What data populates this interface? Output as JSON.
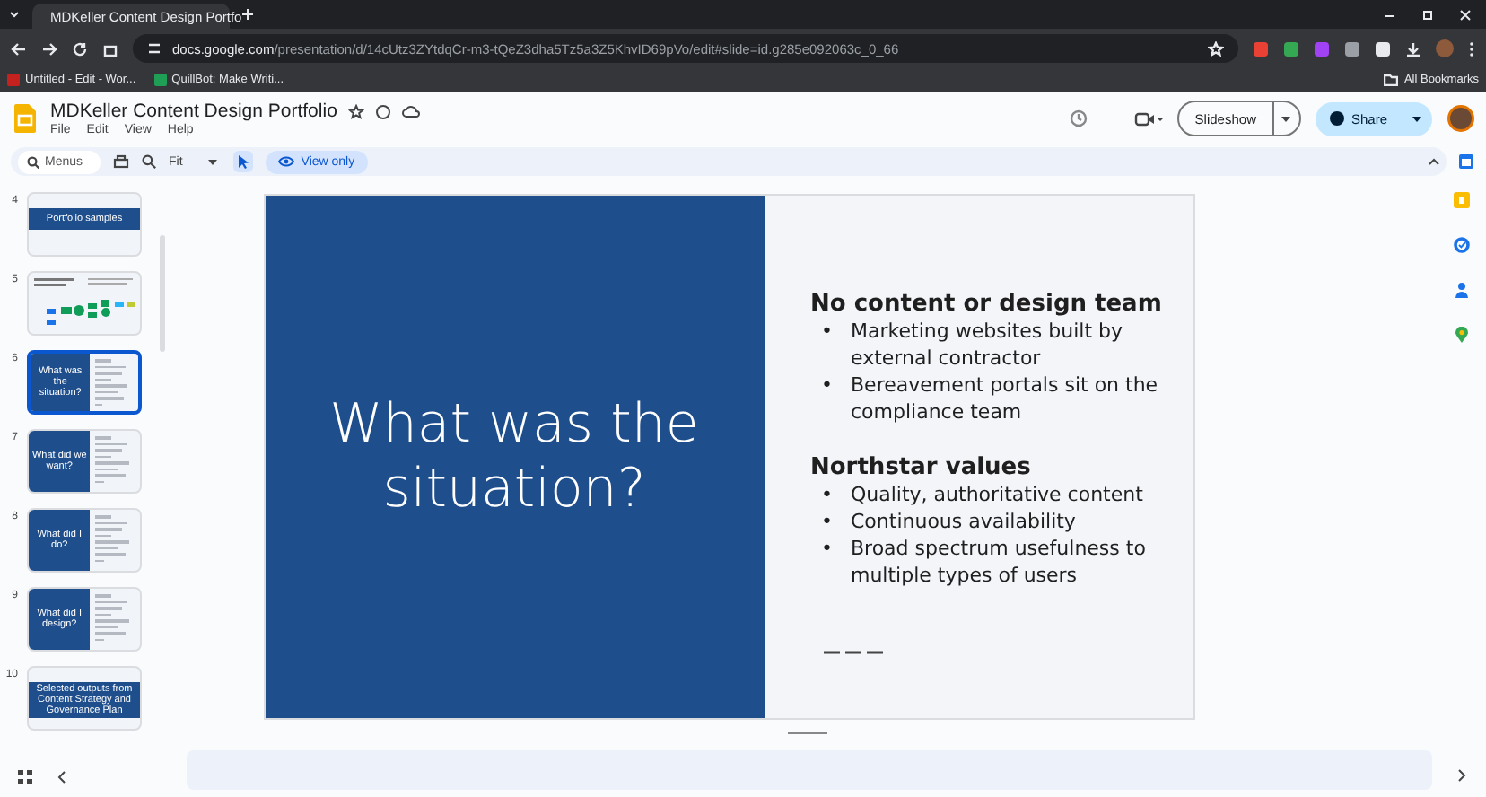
{
  "browser": {
    "tab_title": "MDKeller Content Design Portfo",
    "url_host": "docs.google.com",
    "url_path": "/presentation/d/14cUtz3ZYtdqCr-m3-tQeZ3dha5Tz5a3Z5KhvID69pVo/edit#slide=id.g285e092063c_0_66",
    "bookmarks": [
      "Untitled - Edit - Wor...",
      "QuillBot: Make Writi..."
    ],
    "all_bookmarks": "All Bookmarks"
  },
  "document": {
    "title": "MDKeller Content Design Portfolio",
    "menus": [
      "File",
      "Edit",
      "View",
      "Help"
    ],
    "slideshow_button": "Slideshow",
    "share_button": "Share"
  },
  "toolbar": {
    "search_placeholder": "Menus",
    "zoom": "Fit",
    "view_only": "View only"
  },
  "slides": [
    {
      "number": "4",
      "kind": "title-bar",
      "title": "Portfolio samples",
      "selected": false
    },
    {
      "number": "5",
      "kind": "diagram",
      "selected": false
    },
    {
      "number": "6",
      "kind": "split",
      "title": "What was the situation?",
      "selected": true
    },
    {
      "number": "7",
      "kind": "split",
      "title": "What did we want?",
      "selected": false
    },
    {
      "number": "8",
      "kind": "split",
      "title": "What did I do?",
      "selected": false
    },
    {
      "number": "9",
      "kind": "split",
      "title": "What did I design?",
      "selected": false
    },
    {
      "number": "10",
      "kind": "title-bar",
      "title": "Selected outputs from Content Strategy and Governance Plan",
      "selected": false
    }
  ],
  "slide": {
    "title": "What was the situation?",
    "sections": [
      {
        "heading": "No content or design team",
        "marker": "•",
        "bullets": [
          "Marketing websites built by external contractor",
          "Bereavement portals sit on the compliance team"
        ]
      },
      {
        "heading": "Northstar values",
        "marker": "•",
        "bullets": [
          "Quality, authoritative content",
          "Continuous availability",
          "Broad spectrum usefulness to multiple types of users"
        ]
      }
    ]
  }
}
